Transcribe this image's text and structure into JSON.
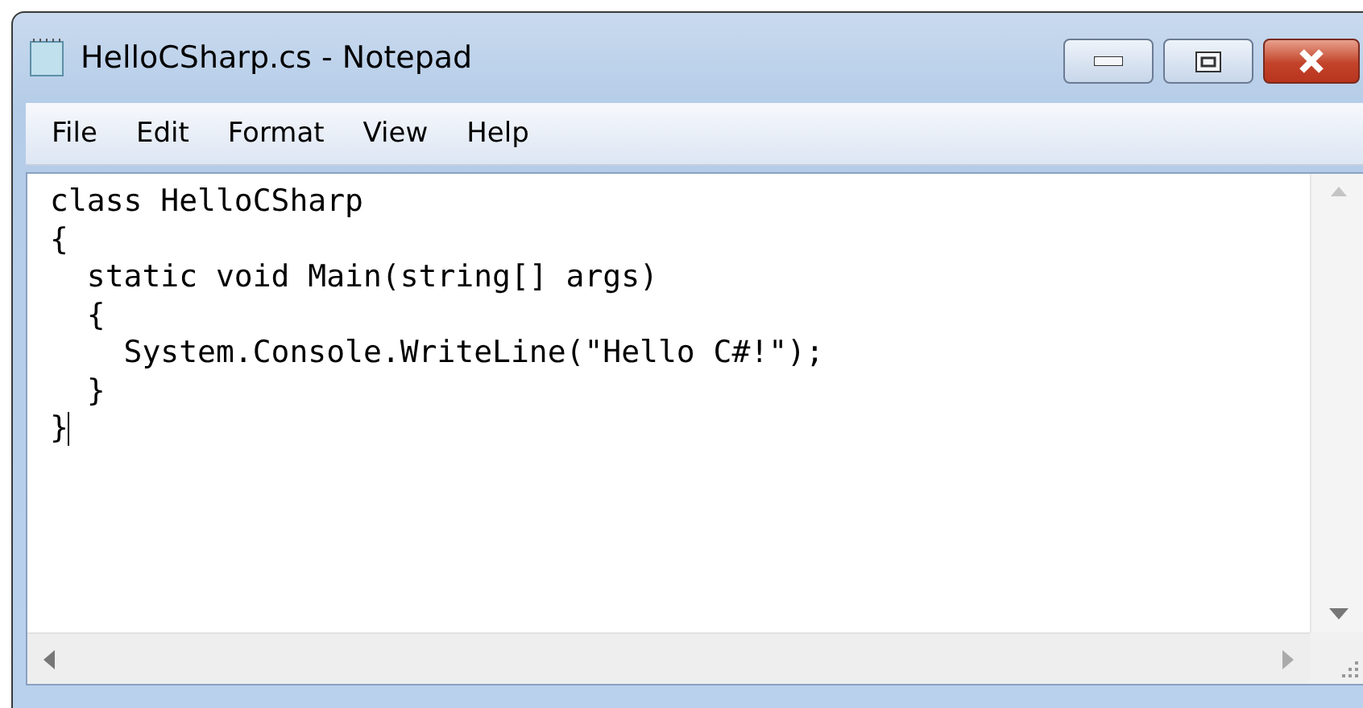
{
  "window": {
    "title": "HelloCSharp.cs - Notepad"
  },
  "menu": [
    "File",
    "Edit",
    "Format",
    "View",
    "Help"
  ],
  "editor": {
    "lines": [
      "class HelloCSharp",
      "{",
      "  static void Main(string[] args)",
      "  {",
      "    System.Console.WriteLine(\"Hello C#!\");",
      "  }",
      "}"
    ]
  }
}
